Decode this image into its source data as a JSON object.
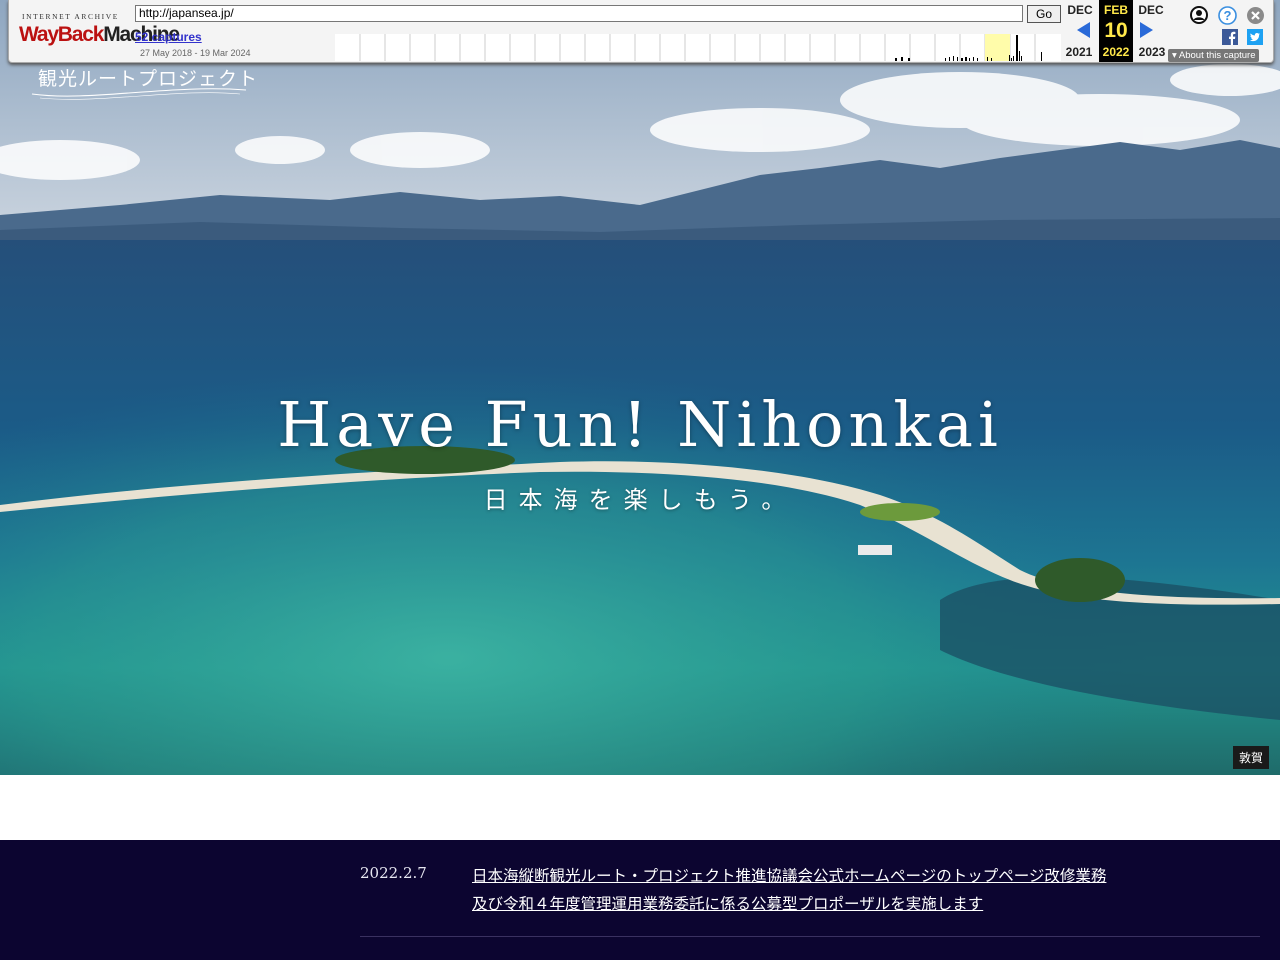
{
  "wayback": {
    "ia_label": "INTERNET ARCHIVE",
    "logo_wayback": "WayBack",
    "logo_machine": "Machine",
    "url": "http://japansea.jp/",
    "go_label": "Go",
    "captures": "52 captures",
    "range": "27 May 2018 - 19 Mar 2024",
    "prev": {
      "month": "DEC",
      "year": "2021"
    },
    "current": {
      "month": "FEB",
      "day": "10",
      "year": "2022"
    },
    "next": {
      "month": "DEC",
      "year": "2023"
    },
    "about": "About this capture",
    "icons": [
      "user-icon",
      "help-icon",
      "close-icon",
      "facebook-icon",
      "twitter-icon"
    ]
  },
  "site": {
    "logo_text": "観光ルートプロジェクト"
  },
  "hero": {
    "title": "Have Fun! Nihonkai",
    "subtitle": "日本海を楽しもう。",
    "location_badge": "敦賀"
  },
  "news": [
    {
      "date": "2022.2.7",
      "title": "日本海縦断観光ルート・プロジェクト推進協議会公式ホームページのトップページ改修業務及び令和４年度管理運用業務委託に係る公募型プロポーザルを実施します"
    }
  ],
  "colors": {
    "news_bg": "#0c0530",
    "wayback_current": "#000000",
    "wayback_current_text": "#ffe84a",
    "wayback_arrow": "#2a6ad8"
  }
}
